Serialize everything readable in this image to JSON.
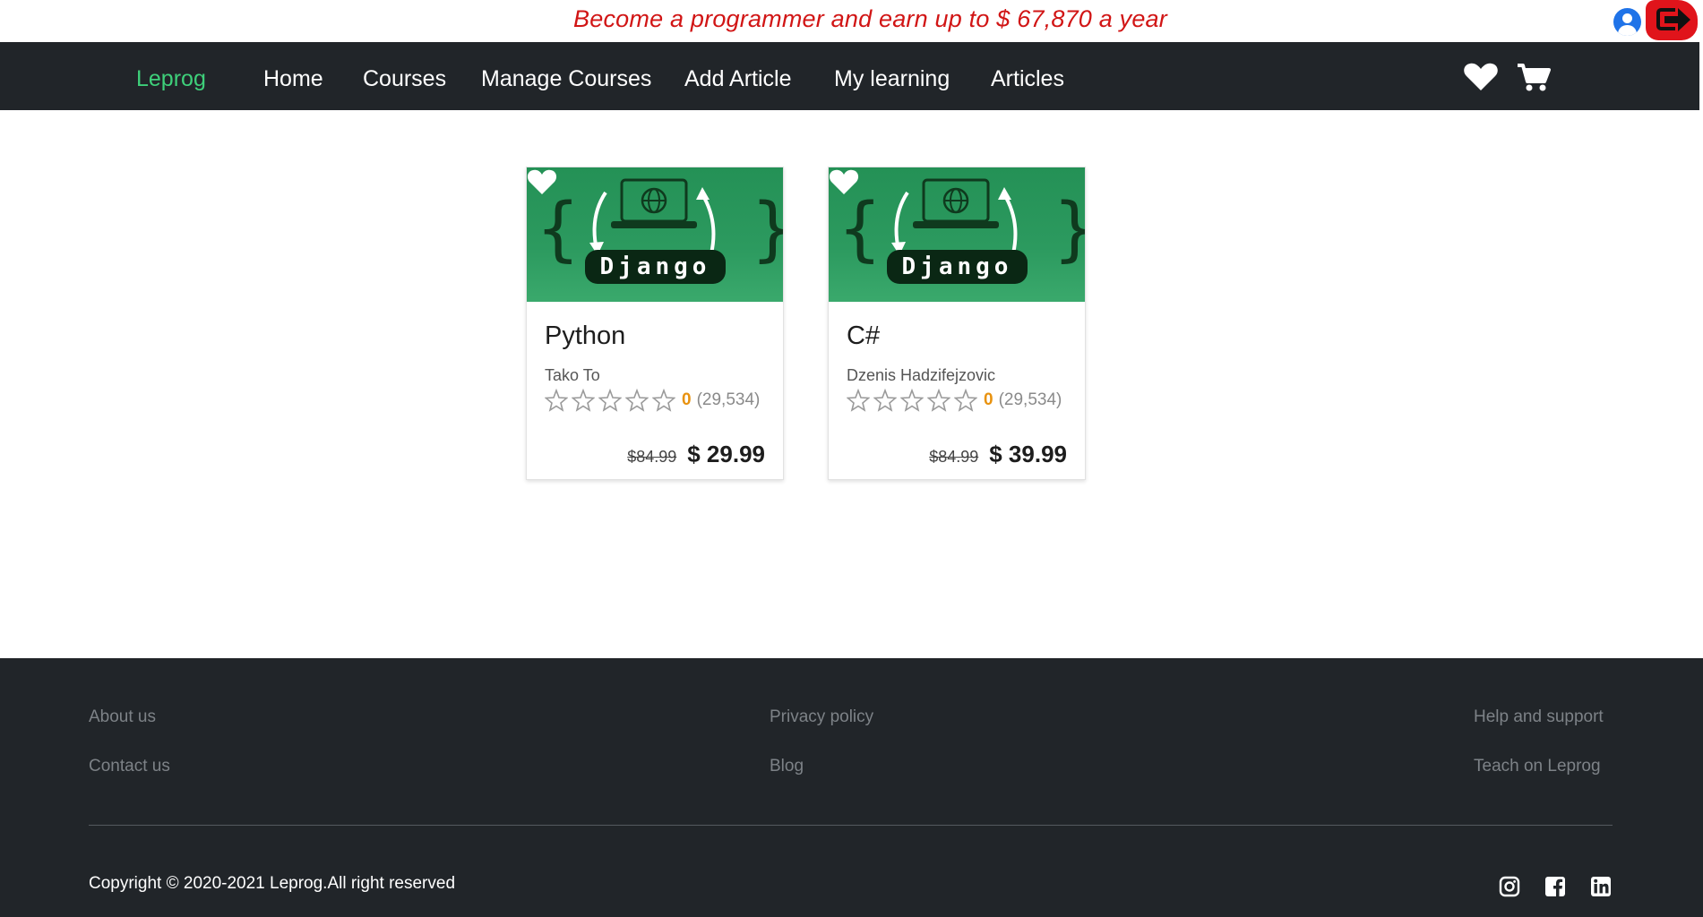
{
  "promo": {
    "text": "Become a programmer and earn up to $ 67,870 a year",
    "user_icon": "user-circle-icon",
    "logout_icon": "sign-out-icon"
  },
  "nav": {
    "brand": "Leprog",
    "links": [
      "Home",
      "Courses",
      "Manage Courses",
      "Add Article",
      "My learning",
      "Articles"
    ],
    "wishlist_icon": "heart-icon",
    "cart_icon": "cart-icon"
  },
  "courses": [
    {
      "image_label": "Django",
      "title": "Python",
      "author": "Tako To",
      "rating": "0",
      "rating_count": "(29,534)",
      "old_price": "$84.99",
      "price": "$ 29.99",
      "stars_filled": 0
    },
    {
      "image_label": "Django",
      "title": "C#",
      "author": "Dzenis Hadzifejzovic",
      "rating": "0",
      "rating_count": "(29,534)",
      "old_price": "$84.99",
      "price": "$ 39.99",
      "stars_filled": 0
    }
  ],
  "footer": {
    "col1": [
      "About us",
      "Contact us"
    ],
    "col2": [
      "Privacy policy",
      "Blog"
    ],
    "col3": [
      "Help and support",
      "Teach on Leprog"
    ],
    "copyright": "Copyright © 2020-2021 Leprog.All right reserved",
    "social_icons": [
      "instagram-icon",
      "facebook-icon",
      "linkedin-icon"
    ]
  },
  "colors": {
    "accent_green": "#3ed07a",
    "promo_red": "#d11515",
    "dark_bg": "#212529",
    "rating_orange": "#e8920f"
  }
}
